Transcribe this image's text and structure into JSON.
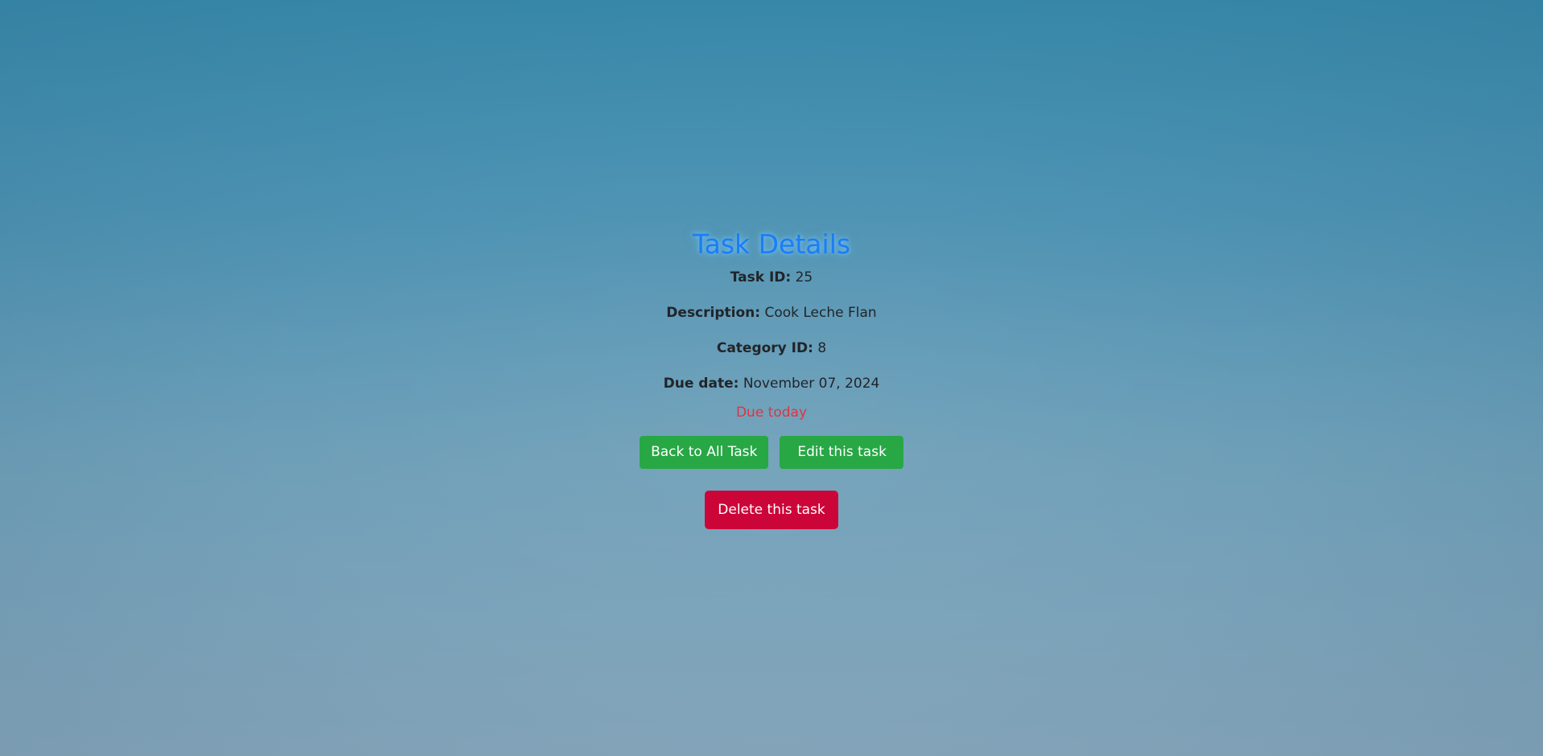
{
  "page": {
    "title": "Task Details"
  },
  "task": {
    "id_label": "Task ID:",
    "id_value": "25",
    "description_label": "Description:",
    "description_value": "Cook Leche Flan",
    "category_label": "Category ID:",
    "category_value": "8",
    "due_label": "Due date:",
    "due_value": "November 07, 2024",
    "due_status": "Due today"
  },
  "actions": {
    "back_label": "Back to All Task",
    "edit_label": "Edit this task",
    "delete_label": "Delete this task"
  },
  "colors": {
    "title": "#1a7ef5",
    "due_status": "#dc3545",
    "primary_button": "#28a745",
    "danger_button": "#cc0538"
  }
}
